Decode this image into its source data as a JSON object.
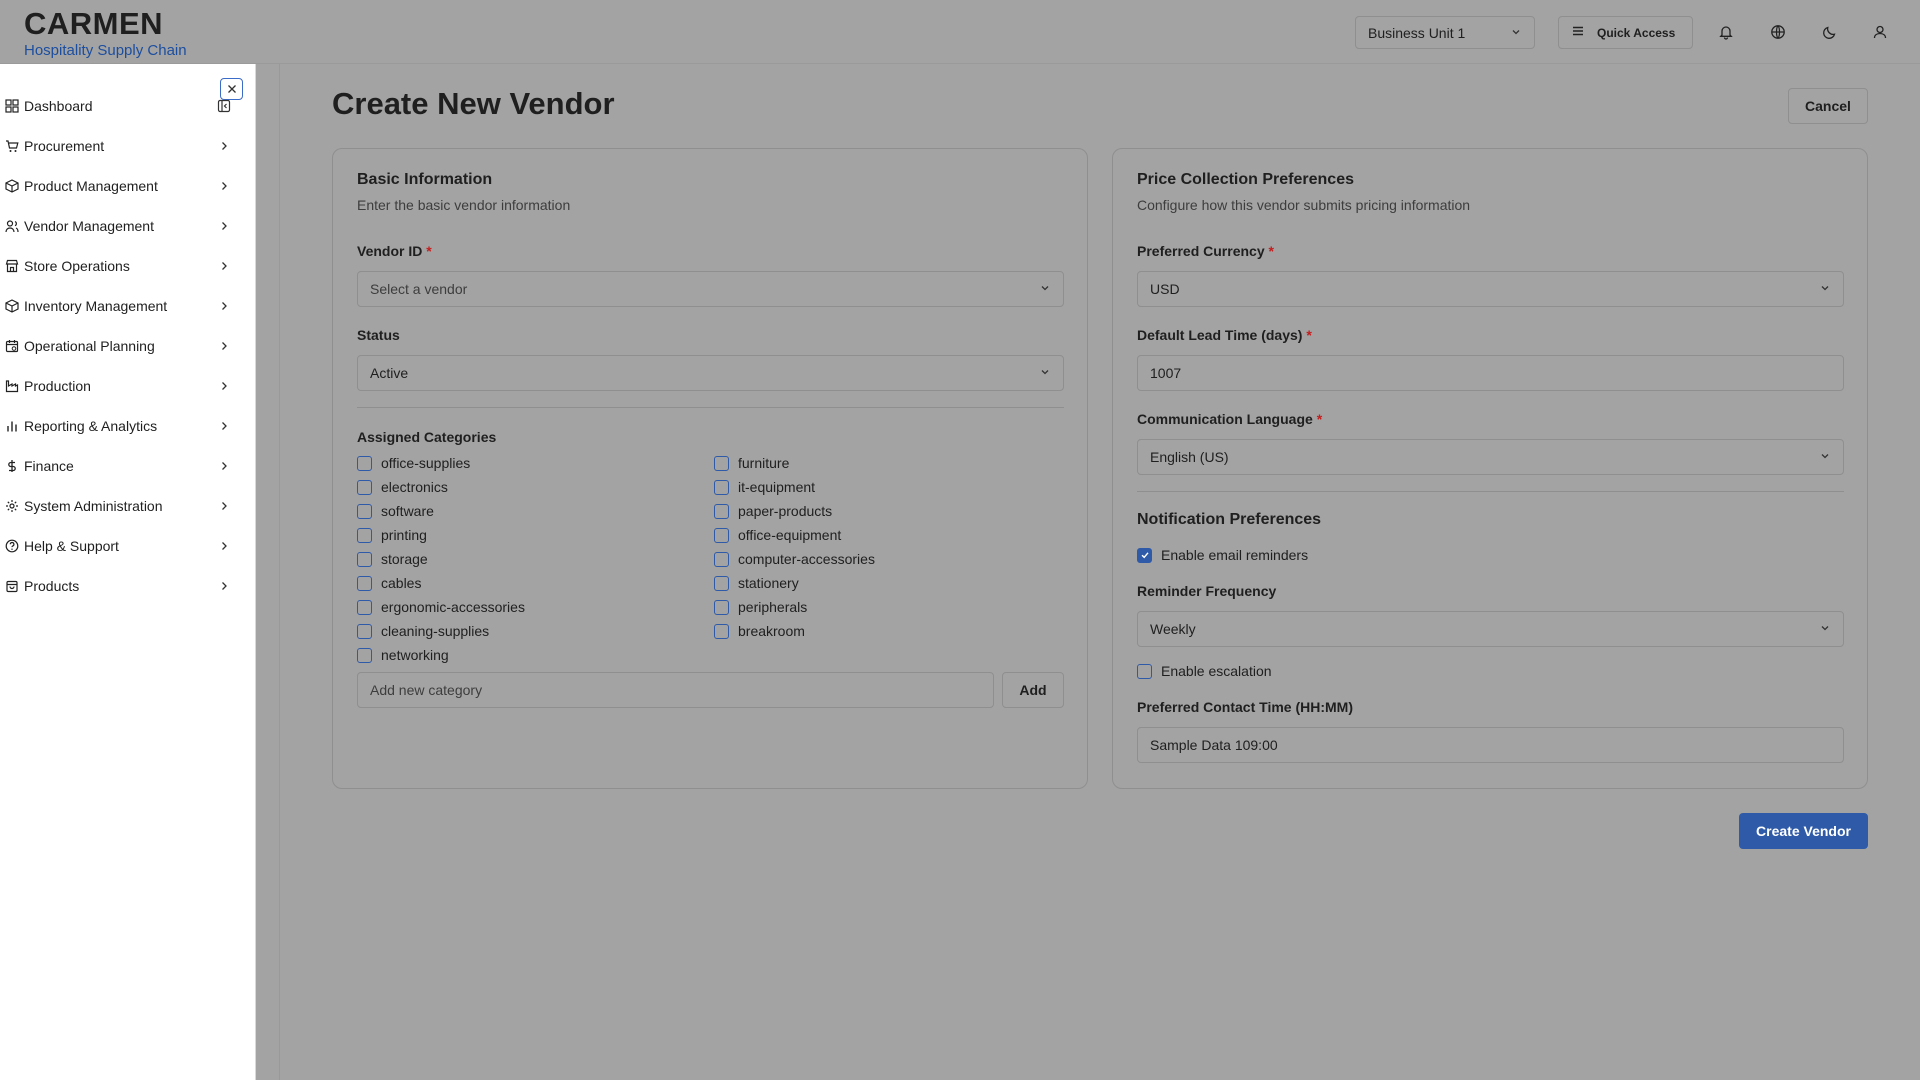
{
  "brand": {
    "title": "CARMEN",
    "subtitle": "Hospitality Supply Chain"
  },
  "header": {
    "business_unit": "Business Unit 1",
    "quick_access": "Quick Access"
  },
  "sidebar": {
    "items": [
      {
        "label": "Dashboard",
        "icon": "dashboard-icon"
      },
      {
        "label": "Procurement",
        "icon": "cart-icon"
      },
      {
        "label": "Product Management",
        "icon": "package-icon"
      },
      {
        "label": "Vendor Management",
        "icon": "users-icon"
      },
      {
        "label": "Store Operations",
        "icon": "store-icon"
      },
      {
        "label": "Inventory Management",
        "icon": "box-icon"
      },
      {
        "label": "Operational Planning",
        "icon": "calendar-icon"
      },
      {
        "label": "Production",
        "icon": "factory-icon"
      },
      {
        "label": "Reporting & Analytics",
        "icon": "bar-chart-icon"
      },
      {
        "label": "Finance",
        "icon": "dollar-icon"
      },
      {
        "label": "System Administration",
        "icon": "gear-icon"
      },
      {
        "label": "Help & Support",
        "icon": "help-icon"
      },
      {
        "label": "Products",
        "icon": "bag-icon"
      }
    ]
  },
  "page": {
    "title": "Create New Vendor",
    "cancel": "Cancel",
    "create": "Create Vendor"
  },
  "basic": {
    "title": "Basic Information",
    "description": "Enter the basic vendor information",
    "vendor_id_label": "Vendor ID",
    "required_mark": "*",
    "vendor_id_placeholder": "Select a vendor",
    "status_label": "Status",
    "status_value": "Active",
    "categories_label": "Assigned Categories",
    "categories_left": [
      "office-supplies",
      "electronics",
      "software",
      "printing",
      "storage",
      "cables",
      "ergonomic-accessories",
      "cleaning-supplies",
      "networking"
    ],
    "categories_right": [
      "furniture",
      "it-equipment",
      "paper-products",
      "office-equipment",
      "computer-accessories",
      "stationery",
      "peripherals",
      "breakroom"
    ],
    "new_category_placeholder": "Add new category",
    "add": "Add"
  },
  "price": {
    "title": "Price Collection Preferences",
    "description": "Configure how this vendor submits pricing information",
    "currency_label": "Preferred Currency",
    "currency_value": "USD",
    "lead_time_label": "Default Lead Time (days)",
    "lead_time_value": "1007",
    "language_label": "Communication Language",
    "language_value": "English (US)",
    "notif_title": "Notification Preferences",
    "email_reminders": "Enable email reminders",
    "email_reminders_checked": true,
    "frequency_label": "Reminder Frequency",
    "frequency_value": "Weekly",
    "escalation": "Enable escalation",
    "escalation_checked": false,
    "contact_time_label": "Preferred Contact Time (HH:MM)",
    "contact_time_value": "Sample Data 109:00"
  }
}
